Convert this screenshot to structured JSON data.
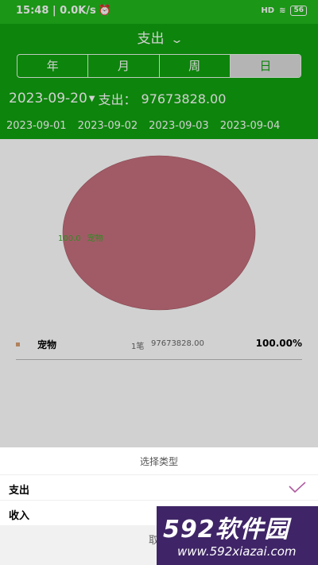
{
  "status_bar": {
    "time": "15:48 | 0.0K/s",
    "alarm_icon": "alarm-icon",
    "signal": "HD",
    "battery": "56"
  },
  "header": {
    "type_title": "支出",
    "tabs": [
      {
        "label": "年",
        "active": false
      },
      {
        "label": "月",
        "active": false
      },
      {
        "label": "周",
        "active": false
      },
      {
        "label": "日",
        "active": true
      }
    ],
    "selected_date": "2023-09-20",
    "amount_label": "支出：",
    "amount_value": "97673828.00",
    "date_strip": [
      "2023-09-01",
      "2023-09-02",
      "2023-09-03",
      "2023-09-04"
    ]
  },
  "chart_data": {
    "type": "pie",
    "slices": [
      {
        "label": "宠物",
        "value": 100.0,
        "color": "#c5707d"
      }
    ]
  },
  "legend": [
    {
      "category": "宠物",
      "count": "1笔",
      "amount": "97673828.00",
      "percent": "100.00%",
      "color": "#d89f72"
    }
  ],
  "sheet": {
    "title": "选择类型",
    "options": [
      {
        "label": "支出",
        "selected": true
      },
      {
        "label": "收入",
        "selected": false
      }
    ],
    "cancel_label": "取消"
  },
  "watermark": {
    "brand": "592软件园",
    "url": "www.592xiazai.com"
  },
  "colors": {
    "header_green": "#10a10f",
    "status_green": "#21b81c",
    "check_purple": "#b05aa0"
  }
}
